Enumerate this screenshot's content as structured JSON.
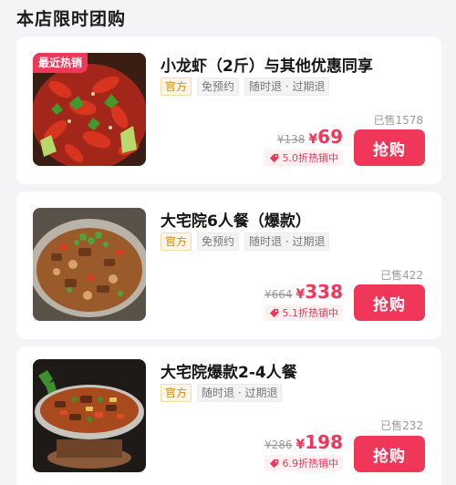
{
  "section": {
    "title": "本店限时团购"
  },
  "deals": [
    {
      "badge": "最近热销",
      "title": "小龙虾（2斤）与其他优惠同享",
      "tags": [
        {
          "label": "官方",
          "style": "official"
        },
        {
          "label": "免预约",
          "style": "plain"
        },
        {
          "label": "随时退 · 过期退",
          "style": "plain"
        }
      ],
      "sold": "已售1578",
      "original_price": "¥138",
      "currency": "¥",
      "price": "69",
      "rank": "5.0折热销中",
      "buy_label": "抢购",
      "image_icon": "crayfish-dish-photo"
    },
    {
      "badge": "",
      "title": "大宅院6人餐（爆款）",
      "tags": [
        {
          "label": "官方",
          "style": "official"
        },
        {
          "label": "免预约",
          "style": "plain"
        },
        {
          "label": "随时退 · 过期退",
          "style": "plain"
        }
      ],
      "sold": "已售422",
      "original_price": "¥664",
      "currency": "¥",
      "price": "338",
      "rank": "5.1折热销中",
      "buy_label": "抢购",
      "image_icon": "stir-fry-dish-photo"
    },
    {
      "badge": "",
      "title": "大宅院爆款2-4人餐",
      "tags": [
        {
          "label": "官方",
          "style": "official"
        },
        {
          "label": "随时退 · 过期退",
          "style": "plain"
        }
      ],
      "sold": "已售232",
      "original_price": "¥286",
      "currency": "¥",
      "price": "198",
      "rank": "6.9折热销中",
      "buy_label": "抢购",
      "image_icon": "dry-pot-dish-photo"
    }
  ],
  "colors": {
    "accent": "#f0375a",
    "official_tag": "#d08a1d",
    "muted": "#9a9a9a"
  }
}
